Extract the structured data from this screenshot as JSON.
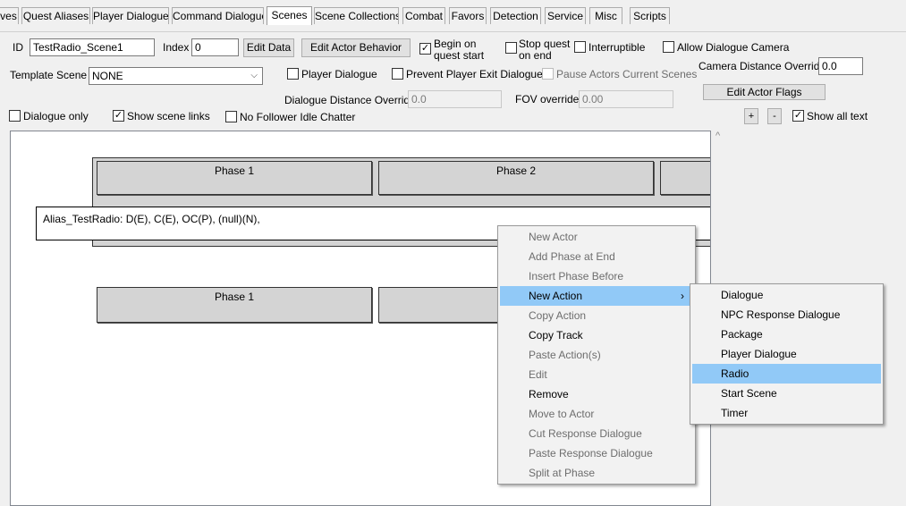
{
  "tabs": [
    {
      "label": "ves"
    },
    {
      "label": "Quest Aliases"
    },
    {
      "label": "Player Dialogue"
    },
    {
      "label": "Command Dialogue"
    },
    {
      "label": "Scenes"
    },
    {
      "label": "Scene Collections"
    },
    {
      "label": "Combat"
    },
    {
      "label": "Favors"
    },
    {
      "label": "Detection"
    },
    {
      "label": "Service"
    },
    {
      "label": "Misc"
    },
    {
      "label": "Scripts"
    }
  ],
  "form": {
    "id_label": "ID",
    "id_value": "TestRadio_Scene1",
    "index_label": "Index",
    "index_value": "0",
    "edit_data": "Edit Data",
    "edit_actor_behavior": "Edit Actor Behavior",
    "begin_on_quest_start_1": "Begin on",
    "begin_on_quest_start_2": "quest start",
    "stop_quest_on_end_1": "Stop quest",
    "stop_quest_on_end_2": "on end",
    "interruptible": "Interruptible",
    "allow_dialogue_camera": "Allow Dialogue Camera",
    "template_scene_label": "Template Scene",
    "template_scene_value": "NONE",
    "player_dialogue": "Player Dialogue",
    "prevent_player_exit": "Prevent Player Exit Dialogue",
    "pause_actors": "Pause Actors Current Scenes",
    "camera_distance_label": "Camera Distance Override",
    "camera_distance_value": "0.0",
    "dialogue_distance_label": "Dialogue Distance Override",
    "dialogue_distance_value": "0.0",
    "fov_label": "FOV override",
    "fov_value": "0.00",
    "edit_actor_flags": "Edit Actor Flags",
    "dialogue_only": "Dialogue only",
    "show_scene_links": "Show scene links",
    "no_follower_idle": "No Follower Idle Chatter",
    "plus": "+",
    "minus": "-",
    "show_all_text": "Show all text"
  },
  "checks": {
    "begin_on_quest_start": true,
    "stop_quest_on_end": false,
    "interruptible": false,
    "allow_dialogue_camera": false,
    "player_dialogue": false,
    "prevent_player_exit": false,
    "pause_actors": false,
    "dialogue_only": false,
    "show_scene_links": true,
    "no_follower_idle": false,
    "show_all_text": true
  },
  "timeline": {
    "top_phases": [
      "Phase 1",
      "Phase 2"
    ],
    "alias_row": "Alias_TestRadio: D(E), C(E), OC(P), (null)(N),",
    "bottom_phases": [
      "Phase 1"
    ]
  },
  "context_menu": [
    {
      "label": "New Actor",
      "enabled": false
    },
    {
      "label": "Add Phase at End",
      "enabled": false
    },
    {
      "label": "Insert Phase Before",
      "enabled": false
    },
    {
      "label": "New Action",
      "enabled": true,
      "highlighted": true,
      "submenu": true
    },
    {
      "label": "Copy Action",
      "enabled": false
    },
    {
      "label": "Copy Track",
      "enabled": true
    },
    {
      "label": "Paste Action(s)",
      "enabled": false
    },
    {
      "label": "Edit",
      "enabled": false
    },
    {
      "label": "Remove",
      "enabled": true
    },
    {
      "label": "Move to Actor",
      "enabled": false
    },
    {
      "label": "Cut Response Dialogue",
      "enabled": false
    },
    {
      "label": "Paste Response Dialogue",
      "enabled": false
    },
    {
      "label": "Split at Phase",
      "enabled": false
    }
  ],
  "submenu": [
    {
      "label": "Dialogue"
    },
    {
      "label": "NPC Response Dialogue"
    },
    {
      "label": "Package"
    },
    {
      "label": "Player Dialogue"
    },
    {
      "label": "Radio",
      "highlighted": true
    },
    {
      "label": "Start Scene"
    },
    {
      "label": "Timer"
    }
  ],
  "colors": {
    "highlight": "#91c9f7",
    "phase_fill": "#d4d4d4",
    "window_bg": "#f0f0f0"
  },
  "icons": {
    "submenu_arrow": "chevron-right-icon",
    "dropdown": "chevron-down-icon",
    "scroll_up": "chevron-up-icon"
  }
}
